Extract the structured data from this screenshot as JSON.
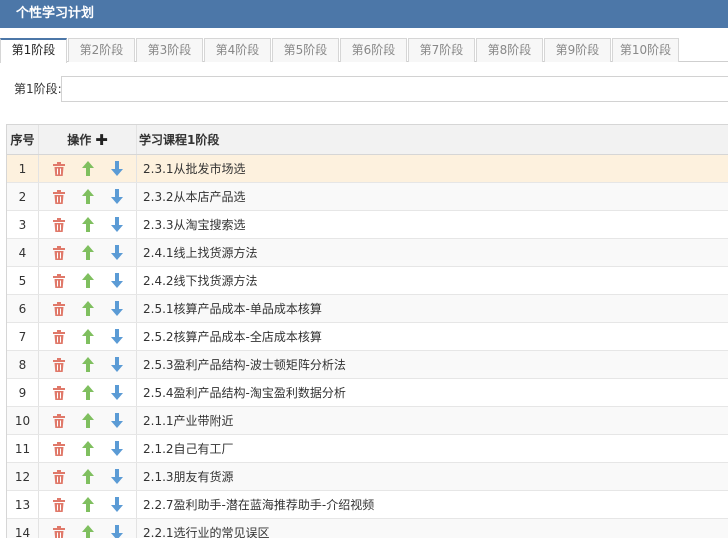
{
  "window": {
    "title": "个性学习计划"
  },
  "tabs": [
    "第1阶段",
    "第2阶段",
    "第3阶段",
    "第4阶段",
    "第5阶段",
    "第6阶段",
    "第7阶段",
    "第8阶段",
    "第9阶段",
    "第10阶段"
  ],
  "active_tab": 0,
  "stage_field": {
    "label": "第1阶段:",
    "value": ""
  },
  "table": {
    "headers": {
      "index": "序号",
      "ops": "操作",
      "course": "学习课程1阶段"
    },
    "selected_row": 0,
    "rows": [
      {
        "index": "1",
        "course": "2.3.1从批发市场选"
      },
      {
        "index": "2",
        "course": "2.3.2从本店产品选"
      },
      {
        "index": "3",
        "course": "2.3.3从淘宝搜索选"
      },
      {
        "index": "4",
        "course": "2.4.1线上找货源方法"
      },
      {
        "index": "5",
        "course": "2.4.2线下找货源方法"
      },
      {
        "index": "6",
        "course": "2.5.1核算产品成本-单品成本核算"
      },
      {
        "index": "7",
        "course": "2.5.2核算产品成本-全店成本核算"
      },
      {
        "index": "8",
        "course": "2.5.3盈利产品结构-波士顿矩阵分析法"
      },
      {
        "index": "9",
        "course": "2.5.4盈利产品结构-淘宝盈利数据分析"
      },
      {
        "index": "10",
        "course": "2.1.1产业带附近"
      },
      {
        "index": "11",
        "course": "2.1.2自己有工厂"
      },
      {
        "index": "12",
        "course": "2.1.3朋友有货源"
      },
      {
        "index": "13",
        "course": "2.2.7盈利助手-潜在蓝海推荐助手-介绍视频"
      },
      {
        "index": "14",
        "course": "2.2.1选行业的常见误区"
      }
    ]
  },
  "icons": {
    "delete": "trash-icon",
    "move_up": "arrow-up-icon",
    "move_down": "arrow-down-icon",
    "add": "plus-icon"
  },
  "colors": {
    "title_bar": "#4c77a8",
    "trash": "#e0796a",
    "arrow_up": "#7fbf5f",
    "arrow_down": "#5b9bd5",
    "selected_row": "#fdf1de"
  }
}
